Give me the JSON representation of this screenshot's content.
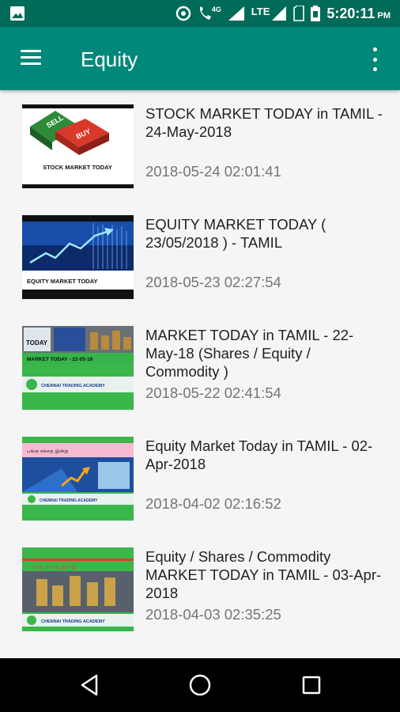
{
  "status_bar": {
    "network_badge": "4G",
    "lte_label": "LTE",
    "time": "5:20:11",
    "ampm": "PM",
    "icons": [
      "image-icon",
      "data-saver-icon",
      "wifi-call-icon",
      "signal-icon",
      "lte-signal-icon",
      "sim-icon",
      "battery-icon"
    ]
  },
  "app_bar": {
    "title": "Equity",
    "background": "#00897b"
  },
  "videos": [
    {
      "title": "STOCK MARKET TODAY in TAMIL - 24-May-2018",
      "date": "2018-05-24 02:01:41",
      "thumb_caption": "STOCK MARKET TODAY",
      "thumb_sell": "SELL",
      "thumb_buy": "BUY"
    },
    {
      "title": "EQUITY MARKET TODAY ( 23/05/2018 ) - TAMIL",
      "date": "2018-05-23 02:27:54",
      "thumb_caption": "EQUITY MARKET TODAY"
    },
    {
      "title": "MARKET TODAY in TAMIL - 22-May-18 (Shares / Equity / Commodity )",
      "date": "2018-05-22 02:41:54",
      "thumb_top": "TODAY",
      "thumb_caption": "MARKET TODAY - 22-05-18",
      "thumb_brand": "CHENNAI TRADING ACADEMY"
    },
    {
      "title": "Equity Market Today in TAMIL - 02-Apr-2018",
      "date": "2018-04-02 02:16:52",
      "thumb_tamil": "பங்கு சந்தை இன்று",
      "thumb_brand": "CHENNAI TRADING ACADEMY"
    },
    {
      "title": "Equity / Shares / Commodity MARKET TODAY in TAMIL - 03-Apr-2018",
      "date": "2018-04-03 02:35:25",
      "thumb_tamil": "பங்கு சந்தை இன்று",
      "thumb_brand": "CHENNAI TRADING ACADEMY"
    }
  ]
}
